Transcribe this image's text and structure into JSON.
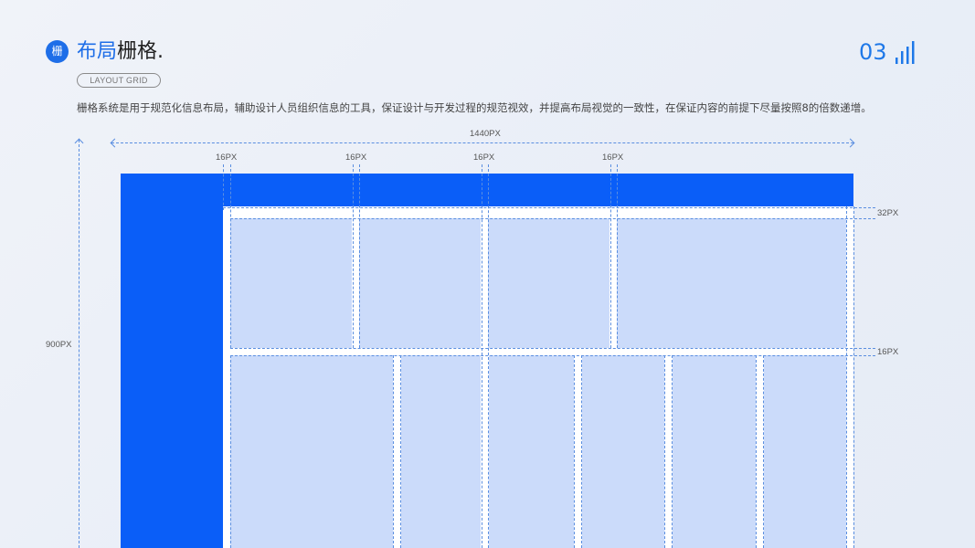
{
  "header": {
    "badge_char": "栅",
    "title_blue": "布局",
    "title_dark": "栅格.",
    "subtitle_pill": "LAYOUT GRID",
    "page_number": "03",
    "page_icon": "bar-chart-icon",
    "accent_color": "#1e6ee8"
  },
  "description": "栅格系统是用于规范化信息布局，辅助设计人员组织信息的工具，保证设计与开发过程的规范视效，并提高布局视觉的一致性，在保证内容的前提下尽量按照8的倍数递增。",
  "diagram": {
    "width_label": "1440PX",
    "height_label": "900PX",
    "gutter_labels": [
      "16PX",
      "16PX",
      "16PX",
      "16PX"
    ],
    "top_margin_label": "32PX",
    "row_gap_label": "16PX",
    "sidebar_color": "#0a5ef8",
    "header_bar_color": "#0a5ef8",
    "cell_color": "#cbdbfa"
  }
}
